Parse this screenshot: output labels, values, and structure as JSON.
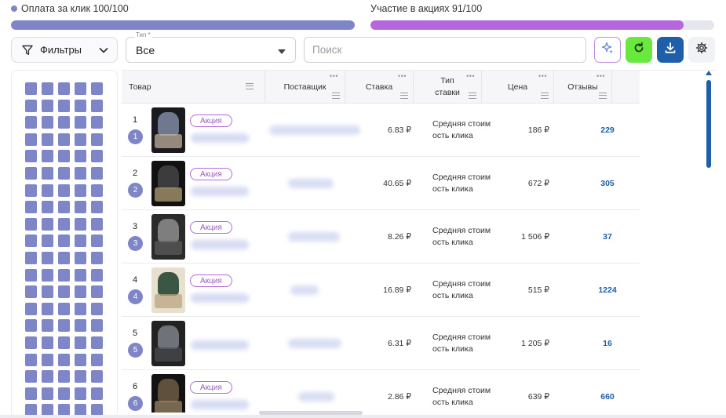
{
  "progress": {
    "click_payment": {
      "label": "Оплата за клик 100/100",
      "fill": 1.0
    },
    "promotions": {
      "label": "Участие в акциях 91/100",
      "fill": 0.91
    }
  },
  "toolbar": {
    "filters_label": "Фильтры",
    "type_legend": "Тип *",
    "type_value": "Все",
    "search_placeholder": "Поиск",
    "icons": {
      "filters": "funnel-icon",
      "filters_toggle": "chevron-down-icon",
      "type_caret": "caret-down-icon",
      "ai": "sparkle-icon",
      "refresh": "refresh-icon",
      "download": "download-icon",
      "settings": "gear-icon"
    }
  },
  "colors": {
    "accent_periwinkle": "#7f86c8",
    "accent_purple": "#b667dd",
    "refresh_green": "#69e83e",
    "download_blue": "#1f5ea8"
  },
  "table": {
    "headers": {
      "product": "Товар",
      "supplier": "Поставщик",
      "rate": "Ставка",
      "type_line1": "Тип",
      "type_line2": "ставки",
      "price": "Цена",
      "reviews": "Отзывы"
    },
    "promo_label": "Акция",
    "rows": [
      {
        "num": "1",
        "badge": "1",
        "promo": true,
        "rate": "6.83 ₽",
        "type1": "Средняя стоим",
        "type2": "ость клика",
        "price": "186 ₽",
        "reviews": "229"
      },
      {
        "num": "2",
        "badge": "2",
        "promo": true,
        "rate": "40.65 ₽",
        "type1": "Средняя стоим",
        "type2": "ость клика",
        "price": "672 ₽",
        "reviews": "305"
      },
      {
        "num": "3",
        "badge": "3",
        "promo": true,
        "rate": "8.26 ₽",
        "type1": "Средняя стоим",
        "type2": "ость клика",
        "price": "1 506 ₽",
        "reviews": "37"
      },
      {
        "num": "4",
        "badge": "4",
        "promo": true,
        "rate": "16.89 ₽",
        "type1": "Средняя стоим",
        "type2": "ость клика",
        "price": "515 ₽",
        "reviews": "1224"
      },
      {
        "num": "5",
        "badge": "5",
        "promo": false,
        "rate": "6.31 ₽",
        "type1": "Средняя стоим",
        "type2": "ость клика",
        "price": "1 205 ₽",
        "reviews": "16"
      },
      {
        "num": "6",
        "badge": "6",
        "promo": true,
        "rate": "2.86 ₽",
        "type1": "Средняя стоим",
        "type2": "ость клика",
        "price": "639 ₽",
        "reviews": "660"
      }
    ]
  }
}
